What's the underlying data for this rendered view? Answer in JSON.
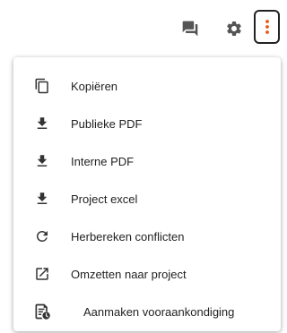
{
  "toolbar": {
    "icons": [
      "comment-icon",
      "gear-icon",
      "more-vert-icon"
    ],
    "accent_color": "#e8590c"
  },
  "menu": {
    "items": [
      {
        "label": "Kopiëren",
        "icon": "copy-icon"
      },
      {
        "label": "Publieke PDF",
        "icon": "download-icon"
      },
      {
        "label": "Interne PDF",
        "icon": "download-icon"
      },
      {
        "label": "Project excel",
        "icon": "download-icon"
      },
      {
        "label": "Herbereken conflicten",
        "icon": "refresh-icon"
      },
      {
        "label": "Omzetten naar project",
        "icon": "open-in-new-icon"
      },
      {
        "label": "Aanmaken vooraankondiging",
        "icon": "document-clock-icon"
      }
    ]
  }
}
